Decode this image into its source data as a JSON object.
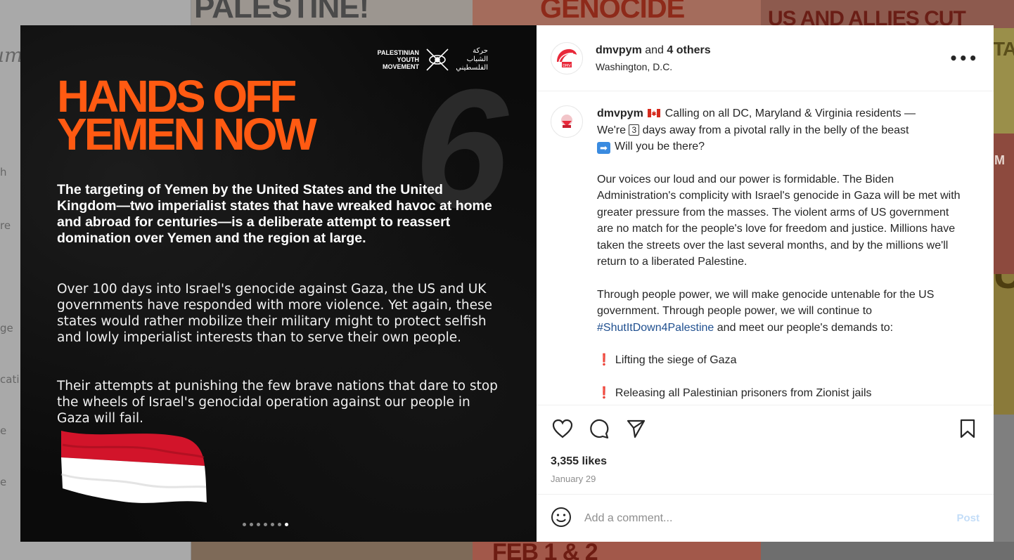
{
  "background": {
    "logo_fragment": "um",
    "nav_fragments": [
      "h",
      "re",
      "ge",
      "cati",
      "e",
      "e"
    ],
    "tile_texts": {
      "top_left": "PALESTINE!",
      "top_middle": "GENOCIDE",
      "top_right": "US AND ALLIES CUT",
      "right_1": "TA",
      "right_2": "M",
      "right_3": "UT",
      "bottom_middle": "FEB 1 & 2"
    }
  },
  "slide": {
    "org_name_en": "PALESTINIAN YOUTH MOVEMENT",
    "org_name_ar": "حركة الشباب الفلسطيني",
    "slide_number": "6",
    "title": "HANDS OFF YEMEN NOW",
    "lead": "The targeting of Yemen by the United States and the United Kingdom—two imperialist states that have wreaked havoc at home and abroad for centuries—is a deliberate attempt to reassert domination over Yemen and the region at large.",
    "paragraph_1": "Over 100 days into Israel's genocide against Gaza, the US and UK governments have responded with more violence. Yet again, these states would rather mobilize their military might to protect selfish and lowly imperialist interests than to serve their own people.",
    "paragraph_2": "Their attempts at punishing the few brave nations that dare to stop the wheels of Israel's genocidal operation against our people in Gaza will fail.",
    "carousel": {
      "count": 7,
      "active_index": 6
    },
    "colors": {
      "title": "#ff5a12",
      "flag_red": "#d2142a",
      "flag_white": "#ffffff"
    }
  },
  "post": {
    "header": {
      "username": "dmvpym",
      "coauthors": "and",
      "others": "4 others",
      "location": "Washington, D.C."
    },
    "caption": {
      "username": "dmvpym",
      "line_1": "Calling on all DC, Maryland & Virginia residents —",
      "line_2_pre": "We're",
      "box_number": "3",
      "line_2_post": "days away from a pivotal rally in the belly of the beast",
      "question": "Will you be there?",
      "paragraph_2": "Our voices our loud and our power is formidable. The Biden Administration's complicity with Israel's genocide in Gaza will be met with greater pressure from the masses. The violent arms of US government are no match for the people's love for freedom and justice. Millions have taken the streets over the last several months, and by the millions we'll return to a liberated Palestine.",
      "paragraph_3_pre": "Through people power, we will make genocide untenable for the US government. Through people power, we will continue to",
      "hashtag": "#ShutItDown4Palestine",
      "paragraph_3_post": "and meet our people's demands to:",
      "demand_1": "Lifting the siege of Gaza",
      "demand_2": "Releasing all Palestinian prisoners from Zionist jails"
    },
    "likes": "3,355 likes",
    "date": "January 29",
    "comment_placeholder": "Add a comment...",
    "post_button": "Post"
  },
  "icons": {
    "like": "heart-icon",
    "comment": "comment-bubble-icon",
    "share": "paper-plane-icon",
    "save": "bookmark-icon",
    "emoji": "smiley-icon",
    "more": "more-options-icon"
  }
}
